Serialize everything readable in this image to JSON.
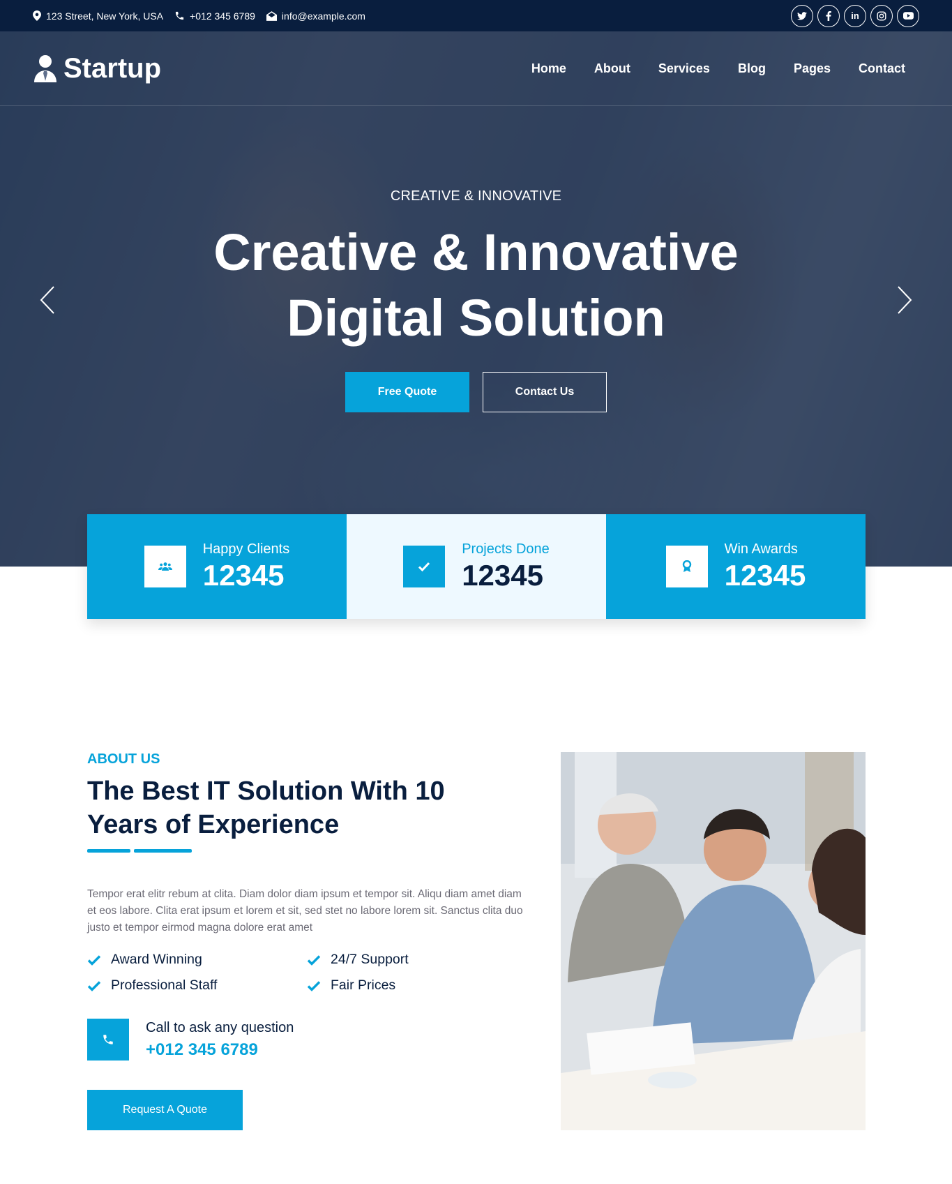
{
  "topbar": {
    "address": "123 Street, New York, USA",
    "phone": "+012 345 6789",
    "email": "info@example.com",
    "socials": [
      "twitter-icon",
      "facebook-icon",
      "linkedin-icon",
      "instagram-icon",
      "youtube-icon"
    ]
  },
  "brand": {
    "name": "Startup"
  },
  "nav": {
    "items": [
      {
        "label": "Home"
      },
      {
        "label": "About"
      },
      {
        "label": "Services"
      },
      {
        "label": "Blog"
      },
      {
        "label": "Pages"
      },
      {
        "label": "Contact"
      }
    ]
  },
  "hero": {
    "kicker": "CREATIVE & INNOVATIVE",
    "title_line1": "Creative & Innovative",
    "title_line2": "Digital Solution",
    "btn_primary": "Free Quote",
    "btn_secondary": "Contact Us"
  },
  "stats": [
    {
      "label": "Happy Clients",
      "value": "12345",
      "icon": "users-icon"
    },
    {
      "label": "Projects Done",
      "value": "12345",
      "icon": "check-icon"
    },
    {
      "label": "Win Awards",
      "value": "12345",
      "icon": "award-icon"
    }
  ],
  "about": {
    "kicker": "ABOUT US",
    "title": "The Best IT Solution With 10 Years of Experience",
    "text": "Tempor erat elitr rebum at clita. Diam dolor diam ipsum et tempor sit. Aliqu diam amet diam et eos labore. Clita erat ipsum et lorem et sit, sed stet no labore lorem sit. Sanctus clita duo justo et tempor eirmod magna dolore erat amet",
    "features": [
      "Award Winning",
      "24/7 Support",
      "Professional Staff",
      "Fair Prices"
    ],
    "call_label": "Call to ask any question",
    "call_number": "+012 345 6789",
    "cta": "Request A Quote"
  },
  "colors": {
    "primary": "#06a3da",
    "dark": "#091e3e",
    "light": "#eef9ff"
  }
}
